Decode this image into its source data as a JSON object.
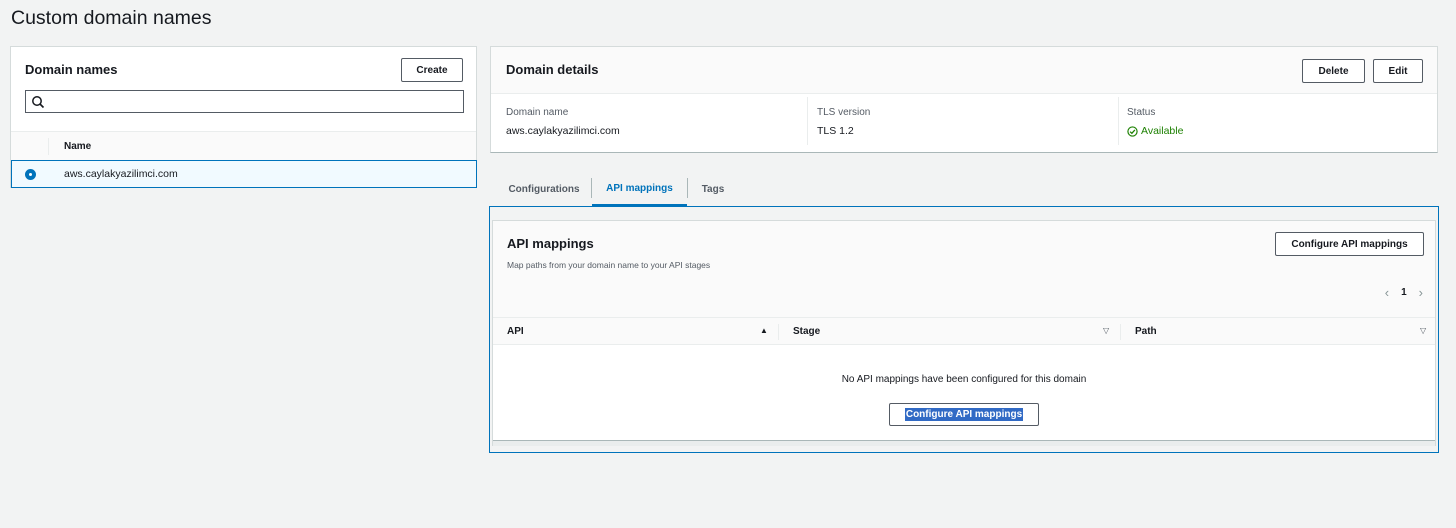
{
  "page": {
    "title": "Custom domain names"
  },
  "domain_names": {
    "title": "Domain names",
    "create_label": "Create",
    "search": {
      "value": "",
      "placeholder": ""
    },
    "columns": {
      "name": "Name"
    },
    "rows": [
      {
        "name": "aws.caylakyazilimci.com",
        "selected": true
      }
    ]
  },
  "details": {
    "title": "Domain details",
    "delete_label": "Delete",
    "edit_label": "Edit",
    "domain_name": {
      "label": "Domain name",
      "value": "aws.caylakyazilimci.com"
    },
    "tls": {
      "label": "TLS version",
      "value": "TLS 1.2"
    },
    "status": {
      "label": "Status",
      "value": "Available",
      "color": "#1d8102"
    }
  },
  "tabs": [
    {
      "label": "Configurations",
      "active": false
    },
    {
      "label": "API mappings",
      "active": true
    },
    {
      "label": "Tags",
      "active": false
    }
  ],
  "mappings": {
    "title": "API mappings",
    "description": "Map paths from your domain name to your API stages",
    "configure_label": "Configure API mappings",
    "page": "1",
    "columns": {
      "api": "API",
      "stage": "Stage",
      "path": "Path"
    },
    "empty_message": "No API mappings have been configured for this domain",
    "empty_button_label": "Configure API mappings"
  },
  "colors": {
    "accent": "#0073bb",
    "background": "#f2f3f3",
    "success": "#1d8102"
  },
  "icons": [
    "search-icon",
    "check-circle-icon",
    "chevron-left-icon",
    "chevron-right-icon",
    "sort-ascending-icon",
    "sort-icon"
  ]
}
